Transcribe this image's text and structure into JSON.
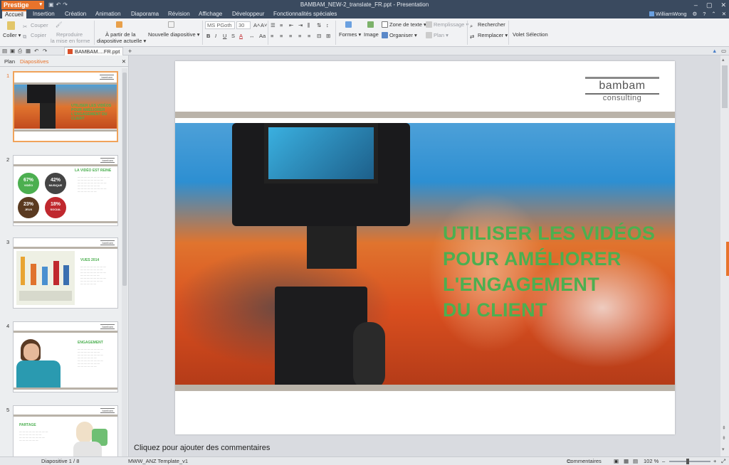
{
  "app": {
    "name": "Prestige"
  },
  "window": {
    "title": "BAMBAM_NEW-2_translate_FR.ppt - Presentation"
  },
  "menu": {
    "tabs": [
      "Accueil",
      "Insertion",
      "Création",
      "Animation",
      "Diaporama",
      "Révision",
      "Affichage",
      "Développeur",
      "Fonctionnalités spéciales"
    ],
    "active": "Accueil"
  },
  "user": {
    "name": "WilliamWong"
  },
  "ribbon": {
    "paste": "Coller",
    "cut": "Couper",
    "copy": "Copier",
    "format_painter_1": "Reproduire",
    "format_painter_2": "la mise en forme",
    "from_current_1": "À partir de la",
    "from_current_2": "diapositive actuelle",
    "new_slide": "Nouvelle diapositive",
    "font_name": "MS PGoth",
    "font_size": "30",
    "shapes": "Formes",
    "image": "Image",
    "textbox": "Zone de texte",
    "arrange": "Organiser",
    "fill": "Remplissage",
    "plan": "Plan",
    "find": "Rechercher",
    "replace": "Remplacer",
    "selection_pane": "Volet Sélection"
  },
  "doc_tab": {
    "label": "BAMBAM....FR.ppt"
  },
  "panel": {
    "tab_plan": "Plan",
    "tab_slides": "Diapositives"
  },
  "thumbnails": [
    {
      "num": "1",
      "title": "UTILISER LES VIDÉOS POUR AMÉLIORER L'ENGAGEMENT DU CLIENT"
    },
    {
      "num": "2",
      "title": "LA VIDÉO EST REINE",
      "stats": [
        {
          "value": "67%",
          "label": "VIDÉO",
          "color": "#4caf50"
        },
        {
          "value": "42%",
          "label": "MUSIQUE",
          "color": "#444444"
        },
        {
          "value": "23%",
          "label": "JEUX",
          "color": "#5a3a20"
        },
        {
          "value": "18%",
          "label": "SOCIAL",
          "color": "#c0282e"
        }
      ]
    },
    {
      "num": "3",
      "title": "VUES 2014"
    },
    {
      "num": "4",
      "title": "ENGAGEMENT"
    },
    {
      "num": "5",
      "title": "PARTAGE"
    }
  ],
  "slide": {
    "logo_main": "bambam",
    "logo_sub": "consulting",
    "title_lines": [
      "UTILISER LES VIDÉOS",
      "POUR AMÉLIORER",
      "L'ENGAGEMENT",
      "DU CLIENT"
    ],
    "title_color": "#4caf50"
  },
  "notes": {
    "placeholder": "Cliquez pour ajouter des commentaires"
  },
  "status": {
    "slide_counter": "Diapositive 1 / 8",
    "template": "MWW_ANZ Template_v1",
    "comments": "Commentaires",
    "zoom": "102 %"
  },
  "colors": {
    "accent": "#e8732b",
    "chrome": "#3a4a5f",
    "green": "#4caf50"
  }
}
